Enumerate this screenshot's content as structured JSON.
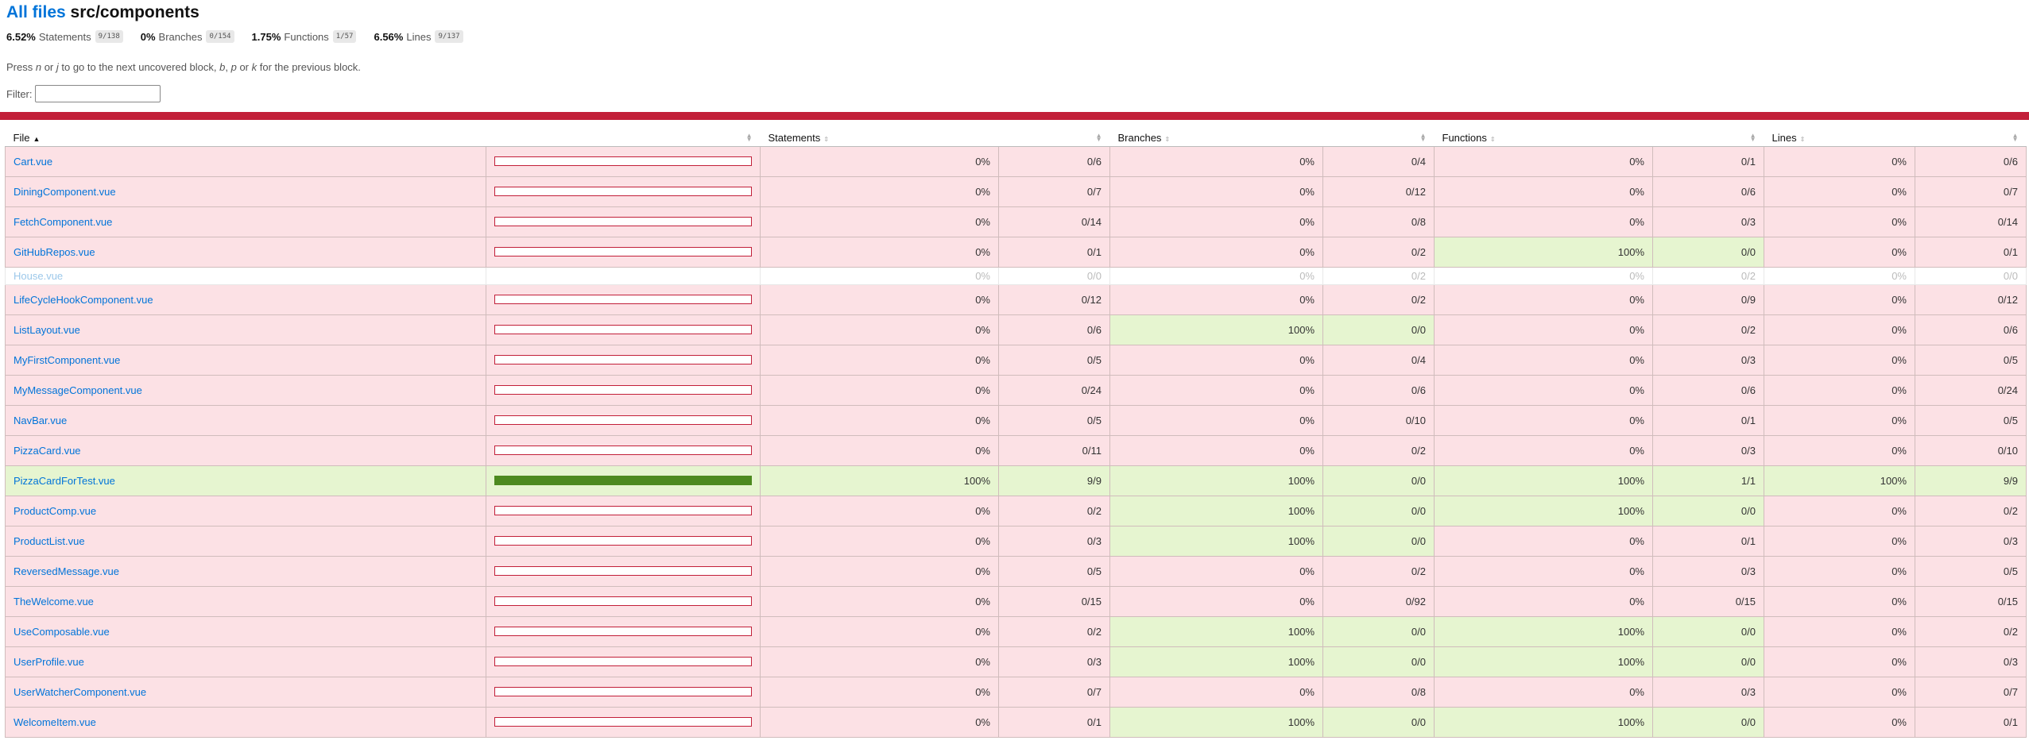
{
  "header": {
    "all_files": "All files",
    "path": "src/components"
  },
  "summary": [
    {
      "pct": "6.52%",
      "label": "Statements",
      "fraction": "9/138"
    },
    {
      "pct": "0%",
      "label": "Branches",
      "fraction": "0/154"
    },
    {
      "pct": "1.75%",
      "label": "Functions",
      "fraction": "1/57"
    },
    {
      "pct": "6.56%",
      "label": "Lines",
      "fraction": "9/137"
    }
  ],
  "hint": {
    "t1": "Press ",
    "k1": "n",
    "t2": " or ",
    "k2": "j",
    "t3": " to go to the next uncovered block, ",
    "k3": "b",
    "t4": ", ",
    "k4": "p",
    "t5": " or ",
    "k5": "k",
    "t6": " for the previous block."
  },
  "filter": {
    "label": "Filter:",
    "value": ""
  },
  "colors": {
    "low": "#fce1e5",
    "high": "#e6f5d0",
    "status_bar": "#c21f39",
    "bar_fill": "#4d8a1f"
  },
  "table": {
    "headers": {
      "file": "File",
      "statements": "Statements",
      "branches": "Branches",
      "functions": "Functions",
      "lines": "Lines"
    },
    "rows": [
      {
        "file": "Cart.vue",
        "cover": 0,
        "s_pct": "0%",
        "s_frac": "0/6",
        "b_pct": "0%",
        "b_frac": "0/4",
        "f_pct": "0%",
        "f_frac": "0/1",
        "l_pct": "0%",
        "l_frac": "0/6",
        "cls": "low"
      },
      {
        "file": "DiningComponent.vue",
        "cover": 0,
        "s_pct": "0%",
        "s_frac": "0/7",
        "b_pct": "0%",
        "b_frac": "0/12",
        "f_pct": "0%",
        "f_frac": "0/6",
        "l_pct": "0%",
        "l_frac": "0/7",
        "cls": "low"
      },
      {
        "file": "FetchComponent.vue",
        "cover": 0,
        "s_pct": "0%",
        "s_frac": "0/14",
        "b_pct": "0%",
        "b_frac": "0/8",
        "f_pct": "0%",
        "f_frac": "0/3",
        "l_pct": "0%",
        "l_frac": "0/14",
        "cls": "low"
      },
      {
        "file": "GitHubRepos.vue",
        "cover": 0,
        "s_pct": "0%",
        "s_frac": "0/1",
        "b_pct": "0%",
        "b_frac": "0/2",
        "f_pct": "100%",
        "f_frac": "0/0",
        "l_pct": "0%",
        "l_frac": "0/1",
        "cls": "low",
        "hi": [
          "f"
        ]
      },
      {
        "file": "House.vue",
        "cover": 0,
        "s_pct": "0%",
        "s_frac": "0/0",
        "b_pct": "0%",
        "b_frac": "0/2",
        "f_pct": "0%",
        "f_frac": "0/2",
        "l_pct": "0%",
        "l_frac": "0/0",
        "cls": "empty"
      },
      {
        "file": "LifeCycleHookComponent.vue",
        "cover": 0,
        "s_pct": "0%",
        "s_frac": "0/12",
        "b_pct": "0%",
        "b_frac": "0/2",
        "f_pct": "0%",
        "f_frac": "0/9",
        "l_pct": "0%",
        "l_frac": "0/12",
        "cls": "low"
      },
      {
        "file": "ListLayout.vue",
        "cover": 0,
        "s_pct": "0%",
        "s_frac": "0/6",
        "b_pct": "100%",
        "b_frac": "0/0",
        "f_pct": "0%",
        "f_frac": "0/2",
        "l_pct": "0%",
        "l_frac": "0/6",
        "cls": "low",
        "hi": [
          "b"
        ]
      },
      {
        "file": "MyFirstComponent.vue",
        "cover": 0,
        "s_pct": "0%",
        "s_frac": "0/5",
        "b_pct": "0%",
        "b_frac": "0/4",
        "f_pct": "0%",
        "f_frac": "0/3",
        "l_pct": "0%",
        "l_frac": "0/5",
        "cls": "low"
      },
      {
        "file": "MyMessageComponent.vue",
        "cover": 0,
        "s_pct": "0%",
        "s_frac": "0/24",
        "b_pct": "0%",
        "b_frac": "0/6",
        "f_pct": "0%",
        "f_frac": "0/6",
        "l_pct": "0%",
        "l_frac": "0/24",
        "cls": "low"
      },
      {
        "file": "NavBar.vue",
        "cover": 0,
        "s_pct": "0%",
        "s_frac": "0/5",
        "b_pct": "0%",
        "b_frac": "0/10",
        "f_pct": "0%",
        "f_frac": "0/1",
        "l_pct": "0%",
        "l_frac": "0/5",
        "cls": "low"
      },
      {
        "file": "PizzaCard.vue",
        "cover": 0,
        "s_pct": "0%",
        "s_frac": "0/11",
        "b_pct": "0%",
        "b_frac": "0/2",
        "f_pct": "0%",
        "f_frac": "0/3",
        "l_pct": "0%",
        "l_frac": "0/10",
        "cls": "low"
      },
      {
        "file": "PizzaCardForTest.vue",
        "cover": 100,
        "s_pct": "100%",
        "s_frac": "9/9",
        "b_pct": "100%",
        "b_frac": "0/0",
        "f_pct": "100%",
        "f_frac": "1/1",
        "l_pct": "100%",
        "l_frac": "9/9",
        "cls": "high"
      },
      {
        "file": "ProductComp.vue",
        "cover": 0,
        "s_pct": "0%",
        "s_frac": "0/2",
        "b_pct": "100%",
        "b_frac": "0/0",
        "f_pct": "100%",
        "f_frac": "0/0",
        "l_pct": "0%",
        "l_frac": "0/2",
        "cls": "low",
        "hi": [
          "b",
          "f"
        ]
      },
      {
        "file": "ProductList.vue",
        "cover": 0,
        "s_pct": "0%",
        "s_frac": "0/3",
        "b_pct": "100%",
        "b_frac": "0/0",
        "f_pct": "0%",
        "f_frac": "0/1",
        "l_pct": "0%",
        "l_frac": "0/3",
        "cls": "low",
        "hi": [
          "b"
        ]
      },
      {
        "file": "ReversedMessage.vue",
        "cover": 0,
        "s_pct": "0%",
        "s_frac": "0/5",
        "b_pct": "0%",
        "b_frac": "0/2",
        "f_pct": "0%",
        "f_frac": "0/3",
        "l_pct": "0%",
        "l_frac": "0/5",
        "cls": "low"
      },
      {
        "file": "TheWelcome.vue",
        "cover": 0,
        "s_pct": "0%",
        "s_frac": "0/15",
        "b_pct": "0%",
        "b_frac": "0/92",
        "f_pct": "0%",
        "f_frac": "0/15",
        "l_pct": "0%",
        "l_frac": "0/15",
        "cls": "low"
      },
      {
        "file": "UseComposable.vue",
        "cover": 0,
        "s_pct": "0%",
        "s_frac": "0/2",
        "b_pct": "100%",
        "b_frac": "0/0",
        "f_pct": "100%",
        "f_frac": "0/0",
        "l_pct": "0%",
        "l_frac": "0/2",
        "cls": "low",
        "hi": [
          "b",
          "f"
        ]
      },
      {
        "file": "UserProfile.vue",
        "cover": 0,
        "s_pct": "0%",
        "s_frac": "0/3",
        "b_pct": "100%",
        "b_frac": "0/0",
        "f_pct": "100%",
        "f_frac": "0/0",
        "l_pct": "0%",
        "l_frac": "0/3",
        "cls": "low",
        "hi": [
          "b",
          "f"
        ]
      },
      {
        "file": "UserWatcherComponent.vue",
        "cover": 0,
        "s_pct": "0%",
        "s_frac": "0/7",
        "b_pct": "0%",
        "b_frac": "0/8",
        "f_pct": "0%",
        "f_frac": "0/3",
        "l_pct": "0%",
        "l_frac": "0/7",
        "cls": "low"
      },
      {
        "file": "WelcomeItem.vue",
        "cover": 0,
        "s_pct": "0%",
        "s_frac": "0/1",
        "b_pct": "100%",
        "b_frac": "0/0",
        "f_pct": "100%",
        "f_frac": "0/0",
        "l_pct": "0%",
        "l_frac": "0/1",
        "cls": "low",
        "hi": [
          "b",
          "f"
        ]
      }
    ]
  }
}
